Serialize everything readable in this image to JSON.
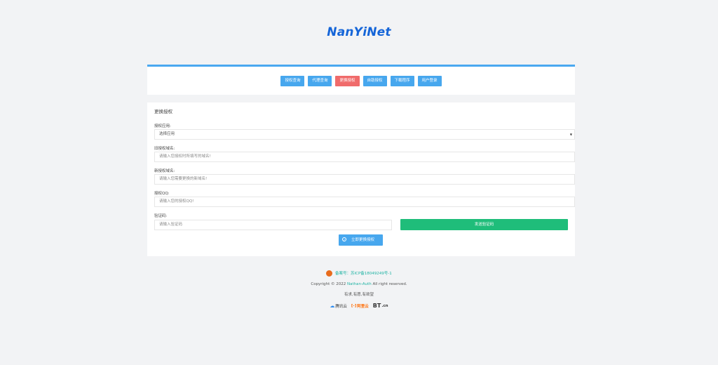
{
  "logo": "NanYiNet",
  "nav": {
    "buttons": [
      "授权查询",
      "代理查询",
      "更换授权",
      "自助授权",
      "下载程序",
      "用户登录"
    ],
    "active_index": 2
  },
  "form": {
    "title": "更换授权",
    "app_label": "授权应用:",
    "app_value": "选择应用",
    "old_domain_label": "旧授权域名:",
    "old_domain_placeholder": "请输入您授权时所填写的域名!",
    "new_domain_label": "新授权域名:",
    "new_domain_placeholder": "请输入您需要更换的新域名!",
    "qq_label": "授权QQ:",
    "qq_placeholder": "请输入您的授权QQ!",
    "code_label": "验证码:",
    "code_placeholder": "请输入验证码",
    "send_code_button": "发送验证码",
    "submit_button": "立即更换授权"
  },
  "footer": {
    "icp": "备案号：苏ICP备18049249号-1",
    "copyright_prefix": "Copyright © 2022",
    "copyright_link": "Nathan-Auth",
    "copyright_suffix": "All right reserved.",
    "motto": "有求,有愿,有欲望",
    "partners": {
      "tencent": "腾讯云",
      "aliyun": "阿里云",
      "bt_big": "BT",
      "bt_small": ".cn"
    }
  },
  "colors": {
    "primary": "#47a7ee",
    "active": "#f06b6b",
    "success": "#1fbd7a",
    "logo": "#1565d8"
  }
}
